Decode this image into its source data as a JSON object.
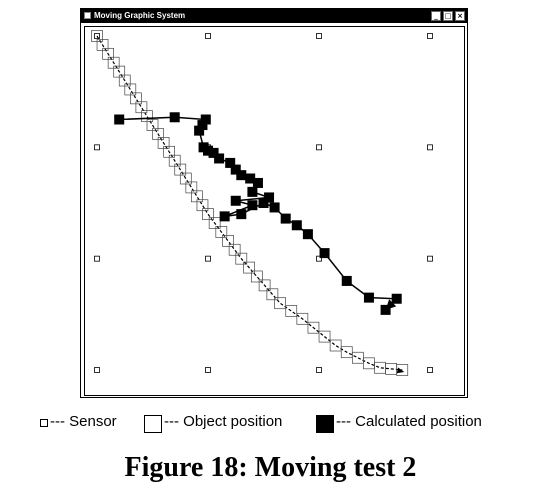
{
  "window": {
    "title": "Moving Graphic System",
    "buttons": {
      "minimize": "_",
      "maximize": "□",
      "close": "×"
    }
  },
  "legend": {
    "sensor_label": "--- Sensor",
    "object_label": "--- Object position",
    "calculated_label": "--- Calculated position"
  },
  "caption": "Figure 18: Moving test 2",
  "colors": {
    "foreground": "#000000",
    "background": "#ffffff"
  },
  "chart_data": {
    "type": "scatter",
    "sensors": {
      "columns": [
        1,
        2,
        3,
        4
      ],
      "rows": [
        1,
        2,
        3,
        4
      ]
    },
    "object_path": [
      [
        1.0,
        1.0
      ],
      [
        1.05,
        1.08
      ],
      [
        1.1,
        1.16
      ],
      [
        1.15,
        1.24
      ],
      [
        1.2,
        1.32
      ],
      [
        1.25,
        1.4
      ],
      [
        1.3,
        1.48
      ],
      [
        1.35,
        1.56
      ],
      [
        1.4,
        1.64
      ],
      [
        1.45,
        1.72
      ],
      [
        1.5,
        1.8
      ],
      [
        1.55,
        1.88
      ],
      [
        1.6,
        1.96
      ],
      [
        1.65,
        2.04
      ],
      [
        1.7,
        2.12
      ],
      [
        1.75,
        2.2
      ],
      [
        1.8,
        2.28
      ],
      [
        1.85,
        2.36
      ],
      [
        1.9,
        2.44
      ],
      [
        1.95,
        2.52
      ],
      [
        2.0,
        2.6
      ],
      [
        2.06,
        2.68
      ],
      [
        2.12,
        2.76
      ],
      [
        2.18,
        2.84
      ],
      [
        2.24,
        2.92
      ],
      [
        2.3,
        3.0
      ],
      [
        2.37,
        3.08
      ],
      [
        2.44,
        3.16
      ],
      [
        2.51,
        3.24
      ],
      [
        2.58,
        3.32
      ],
      [
        2.65,
        3.4
      ],
      [
        2.75,
        3.47
      ],
      [
        2.85,
        3.54
      ],
      [
        2.95,
        3.62
      ],
      [
        3.05,
        3.7
      ],
      [
        3.15,
        3.78
      ],
      [
        3.25,
        3.84
      ],
      [
        3.35,
        3.89
      ],
      [
        3.45,
        3.94
      ],
      [
        3.55,
        3.98
      ],
      [
        3.65,
        3.99
      ],
      [
        3.75,
        4.0
      ]
    ],
    "calculated_path": [
      [
        1.2,
        1.75
      ],
      [
        1.7,
        1.73
      ],
      [
        1.98,
        1.75
      ],
      [
        1.95,
        1.8
      ],
      [
        1.92,
        1.85
      ],
      [
        1.96,
        2.0
      ],
      [
        2.0,
        2.03
      ],
      [
        2.05,
        2.05
      ],
      [
        2.1,
        2.1
      ],
      [
        2.2,
        2.14
      ],
      [
        2.25,
        2.2
      ],
      [
        2.3,
        2.25
      ],
      [
        2.38,
        2.28
      ],
      [
        2.45,
        2.32
      ],
      [
        2.4,
        2.4
      ],
      [
        2.55,
        2.45
      ],
      [
        2.25,
        2.48
      ],
      [
        2.4,
        2.52
      ],
      [
        2.15,
        2.62
      ],
      [
        2.3,
        2.6
      ],
      [
        2.5,
        2.5
      ],
      [
        2.6,
        2.54
      ],
      [
        2.7,
        2.64
      ],
      [
        2.8,
        2.7
      ],
      [
        2.9,
        2.78
      ],
      [
        3.05,
        2.95
      ],
      [
        3.25,
        3.2
      ],
      [
        3.45,
        3.35
      ],
      [
        3.7,
        3.36
      ],
      [
        3.6,
        3.46
      ]
    ],
    "xlim": [
      0.9,
      4.1
    ],
    "ylim": [
      0.9,
      4.1
    ],
    "grid": false
  }
}
